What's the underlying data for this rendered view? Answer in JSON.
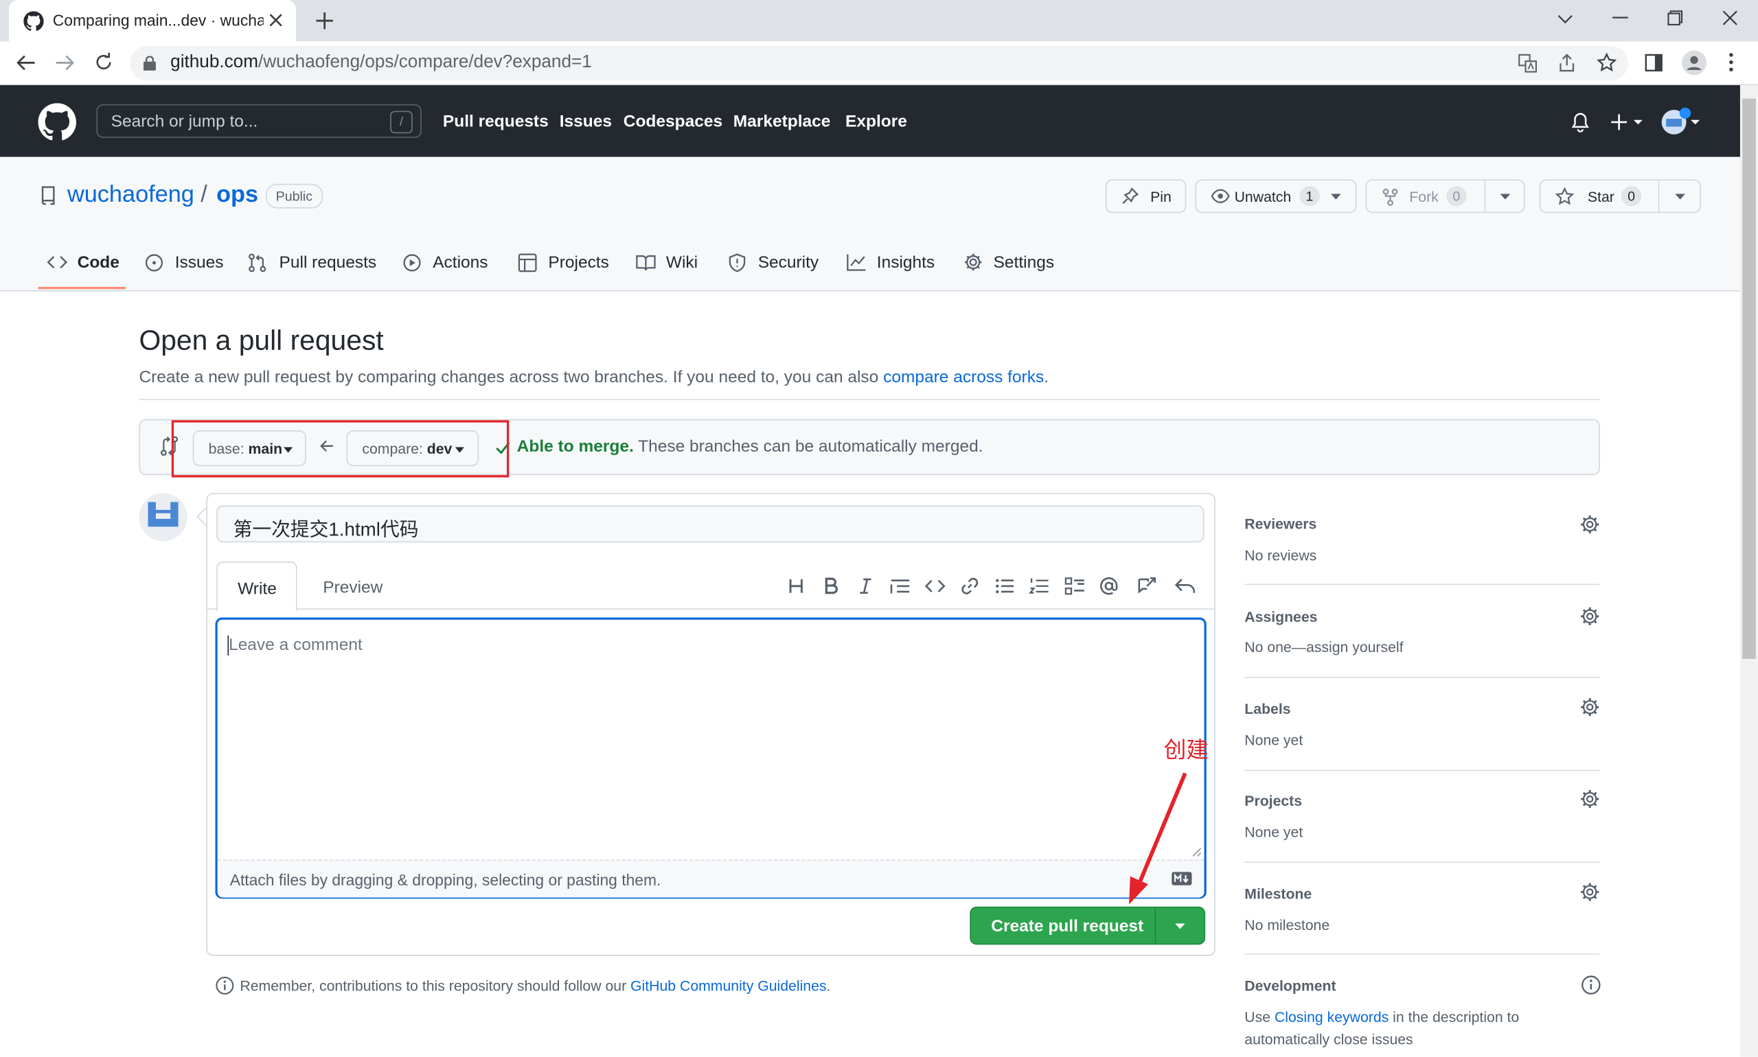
{
  "browser": {
    "tab_title": "Comparing main...dev · wuchaofeng/ops",
    "url_host": "github.com",
    "url_path": "/wuchaofeng/ops/compare/dev?expand=1"
  },
  "header": {
    "search_placeholder": "Search or jump to...",
    "search_shortcut": "/",
    "nav": [
      "Pull requests",
      "Issues",
      "Codespaces",
      "Marketplace",
      "Explore"
    ]
  },
  "repo": {
    "owner": "wuchaofeng",
    "separator": "/",
    "name": "ops",
    "visibility": "Public",
    "pin_label": "Pin",
    "unwatch_label": "Unwatch",
    "unwatch_count": "1",
    "fork_label": "Fork",
    "fork_count": "0",
    "star_label": "Star",
    "star_count": "0",
    "tabs": [
      "Code",
      "Issues",
      "Pull requests",
      "Actions",
      "Projects",
      "Wiki",
      "Security",
      "Insights",
      "Settings"
    ]
  },
  "compare": {
    "heading": "Open a pull request",
    "subtitle_text": "Create a new pull request by comparing changes across two branches. If you need to, you can also ",
    "subtitle_link": "compare across forks",
    "subtitle_end": ".",
    "base_label": "base:",
    "base_value": "main",
    "compare_label": "compare:",
    "compare_value": "dev",
    "merge_status": "Able to merge.",
    "merge_detail": "These branches can be automatically merged."
  },
  "editor": {
    "title_value": "第一次提交1.html代码",
    "write_tab": "Write",
    "preview_tab": "Preview",
    "comment_placeholder": "Leave a comment",
    "attach_hint": "Attach files by dragging & dropping, selecting or pasting them.",
    "create_button": "Create pull request",
    "annotation": "创建",
    "remember_text": "Remember, contributions to this repository should follow our ",
    "remember_link": "GitHub Community Guidelines",
    "remember_end": "."
  },
  "sidebar": {
    "reviewers": {
      "label": "Reviewers",
      "value": "No reviews"
    },
    "assignees": {
      "label": "Assignees",
      "value": "No one—assign yourself"
    },
    "labels": {
      "label": "Labels",
      "value": "None yet"
    },
    "projects": {
      "label": "Projects",
      "value": "None yet"
    },
    "milestone": {
      "label": "Milestone",
      "value": "No milestone"
    },
    "development": {
      "label": "Development",
      "text_before": "Use ",
      "link": "Closing keywords",
      "text_after": " in the description to",
      "text_line2": "automatically close issues"
    }
  },
  "colors": {
    "header_bg": "#24292f",
    "primary_button": "#2da44e",
    "link": "#0969da",
    "annotation_red": "#e5232a"
  }
}
